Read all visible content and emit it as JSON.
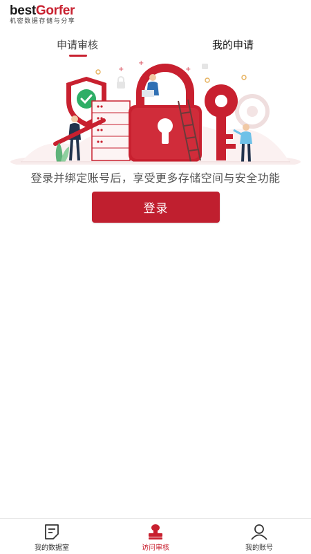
{
  "brand": {
    "name_prefix": "best",
    "name_suffix": "Gorfer",
    "tagline": "机密数据存储与分享",
    "accent_color": "#c8202f"
  },
  "tabs": [
    {
      "label": "申请审核",
      "active": true
    },
    {
      "label": "我的申请",
      "active": false
    }
  ],
  "illustration": {
    "icon": "security-lock-illustration"
  },
  "main": {
    "message": "登录并绑定账号后，享受更多存储空间与安全功能",
    "login_button": "登录"
  },
  "bottom_nav": [
    {
      "label": "我的数据室",
      "icon": "note-icon",
      "active": false
    },
    {
      "label": "访问审核",
      "icon": "stamp-icon",
      "active": true
    },
    {
      "label": "我的账号",
      "icon": "person-icon",
      "active": false
    }
  ]
}
